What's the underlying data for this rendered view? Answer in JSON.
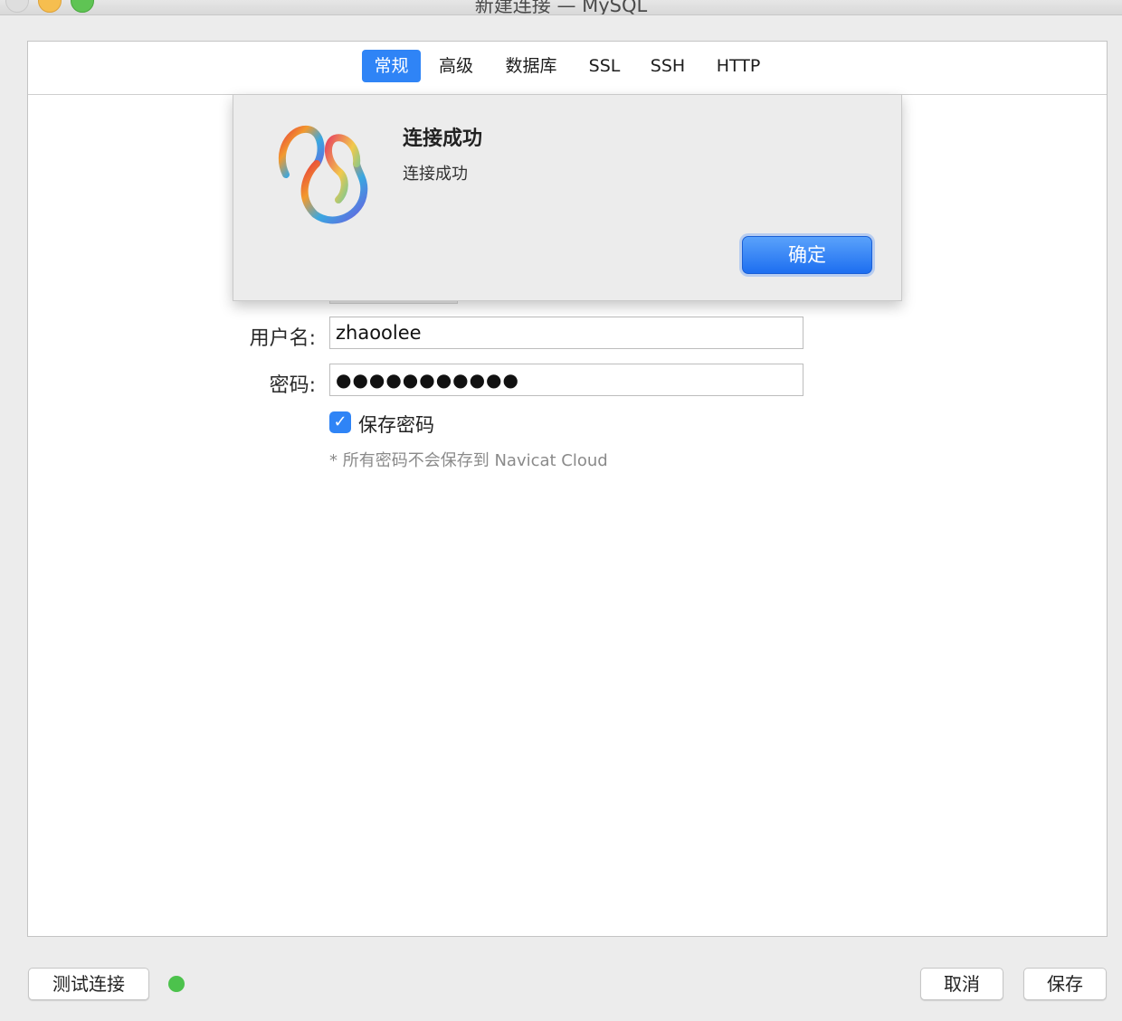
{
  "window": {
    "title": "新建连接 — MySQL"
  },
  "tabs": [
    {
      "label": "常规",
      "active": true
    },
    {
      "label": "高级"
    },
    {
      "label": "数据库"
    },
    {
      "label": "SSL"
    },
    {
      "label": "SSH"
    },
    {
      "label": "HTTP"
    }
  ],
  "form": {
    "username_label": "用户名:",
    "username_value": "zhaoolee",
    "password_label": "密码:",
    "password_value": "●●●●●●●●●●●",
    "save_password_label": "保存密码",
    "save_password_checked": true,
    "note": "* 所有密码不会保存到 Navicat Cloud"
  },
  "dialog": {
    "title": "连接成功",
    "message": "连接成功",
    "ok_label": "确定",
    "icon": "navicat-logo-icon"
  },
  "footer": {
    "test_label": "测试连接",
    "status_color": "#4cc24c",
    "cancel_label": "取消",
    "save_label": "保存"
  },
  "colors": {
    "accent": "#2f84f6",
    "success": "#4cc24c"
  }
}
